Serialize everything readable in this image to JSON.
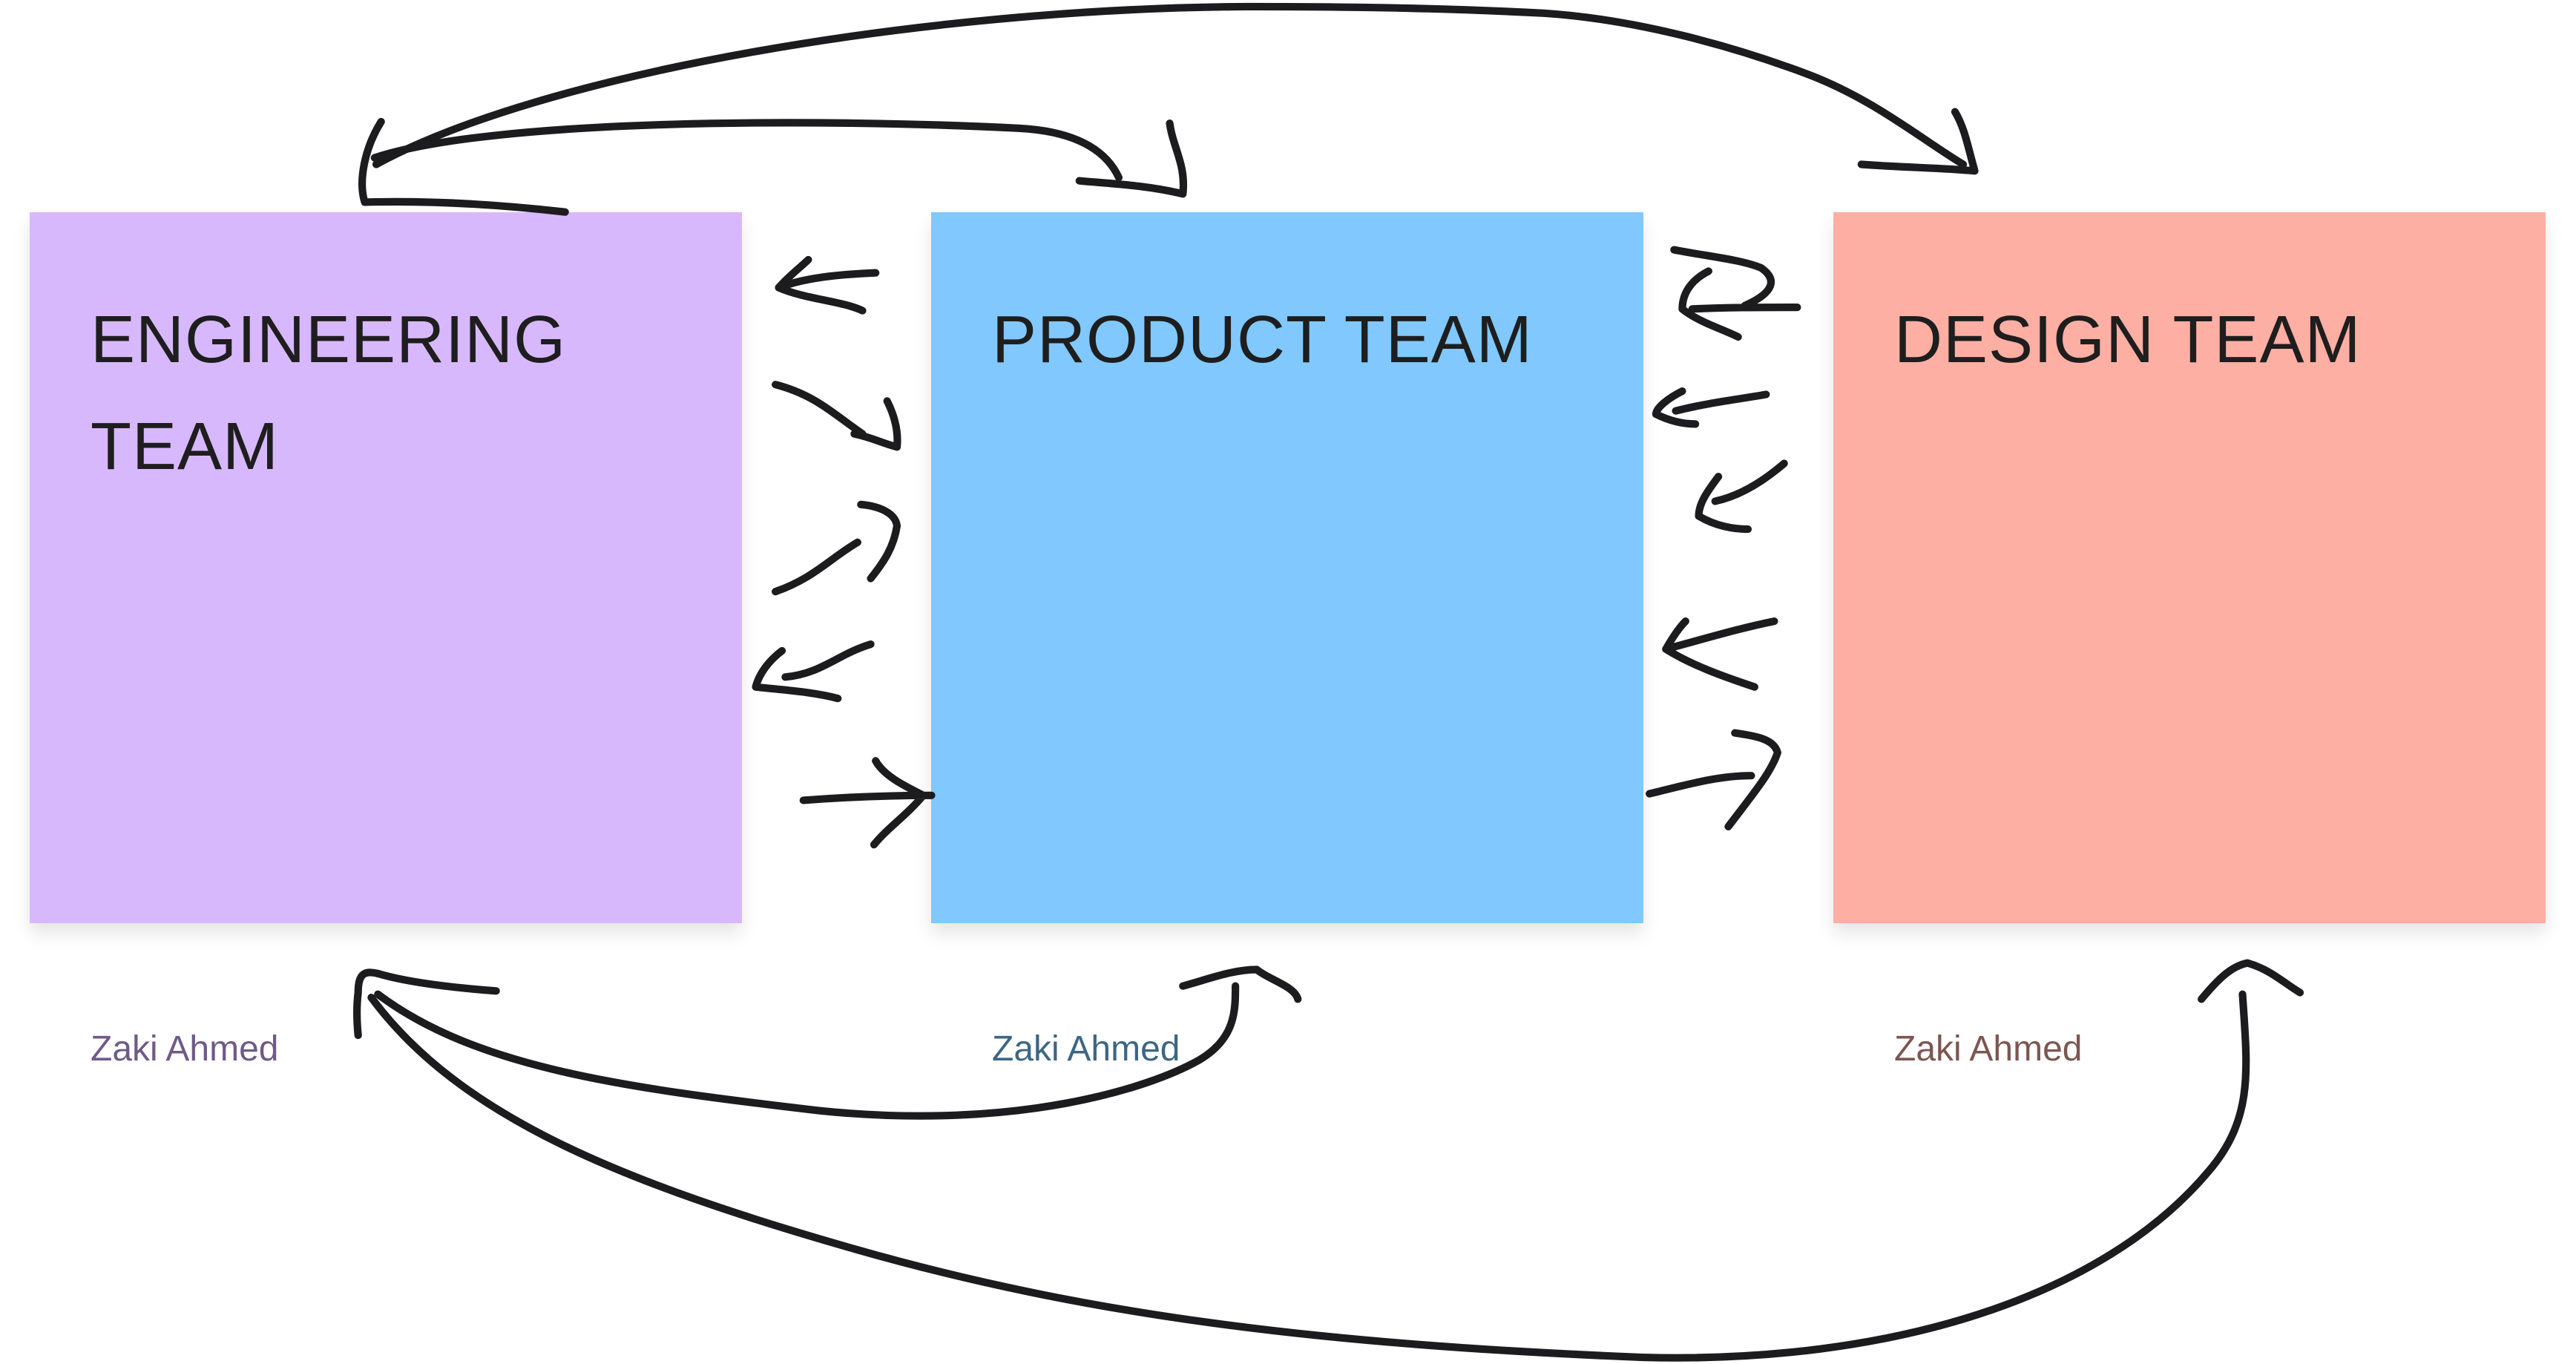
{
  "stickies": [
    {
      "title": "ENGINEERING TEAM",
      "author": "Zaki Ahmed",
      "color": "#d8b8fd"
    },
    {
      "title": "PRODUCT TEAM",
      "author": "Zaki Ahmed",
      "color": "#80c8fe"
    },
    {
      "title": "DESIGN TEAM",
      "author": "Zaki Ahmed",
      "color": "#feafa3"
    }
  ],
  "stroke_color": "#1c1c1e"
}
